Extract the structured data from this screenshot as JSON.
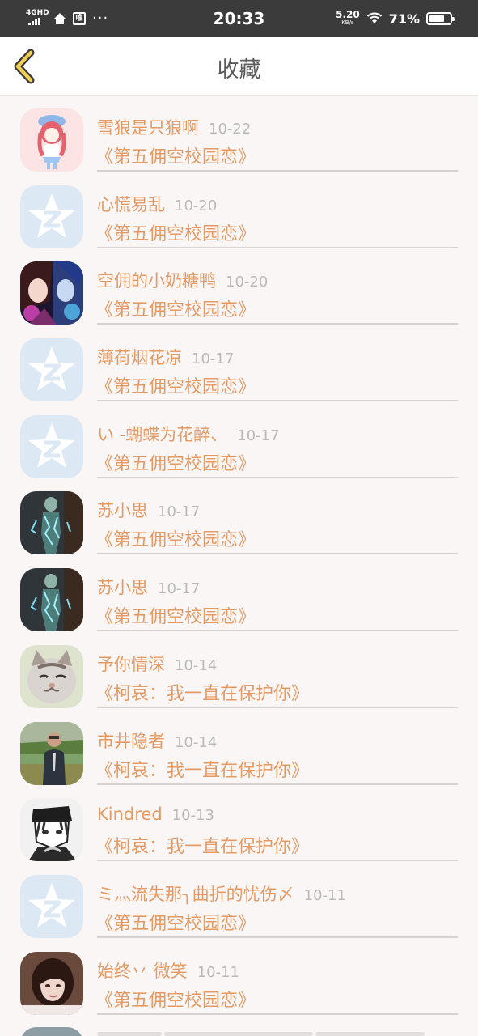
{
  "status_bar": {
    "network": "4GHD",
    "box_icon_text": "唯",
    "dots": "···",
    "time": "20:33",
    "speed_value": "5.20",
    "speed_unit": "KB/s",
    "battery_percent": "71%"
  },
  "header": {
    "title": "收藏"
  },
  "favorites": [
    {
      "name": "雪狼是只狼啊",
      "date": "10-22",
      "title": "《第五佣空校园恋》",
      "avatar": "anime-girl"
    },
    {
      "name": "心慌易乱",
      "date": "10-20",
      "title": "《第五佣空校园恋》",
      "avatar": "default"
    },
    {
      "name": "空佣的小奶糖鸭",
      "date": "10-20",
      "title": "《第五佣空校园恋》",
      "avatar": "anime-duo"
    },
    {
      "name": "薄荷烟花凉",
      "date": "10-17",
      "title": "《第五佣空校园恋》",
      "avatar": "default"
    },
    {
      "name": "い -蝴蝶为花醉、",
      "date": "10-17",
      "title": "《第五佣空校园恋》",
      "avatar": "default"
    },
    {
      "name": "苏小思",
      "date": "10-17",
      "title": "《第五佣空校园恋》",
      "avatar": "electric"
    },
    {
      "name": "苏小思",
      "date": "10-17",
      "title": "《第五佣空校园恋》",
      "avatar": "electric"
    },
    {
      "name": "予你情深",
      "date": "10-14",
      "title": "《柯哀：我一直在保护你》",
      "avatar": "cat"
    },
    {
      "name": "市井隐者",
      "date": "10-14",
      "title": "《柯哀：我一直在保护你》",
      "avatar": "man-field"
    },
    {
      "name": "Kindred",
      "date": "10-13",
      "title": "《柯哀：我一直在保护你》",
      "avatar": "manga-bw"
    },
    {
      "name": "ミ灬流失那╮曲折的忧伤〆",
      "date": "10-11",
      "title": "《第五佣空校园恋》",
      "avatar": "default"
    },
    {
      "name": "始终丷 微笑",
      "date": "10-11",
      "title": "《第五佣空校园恋》",
      "avatar": "girl-photo"
    }
  ]
}
